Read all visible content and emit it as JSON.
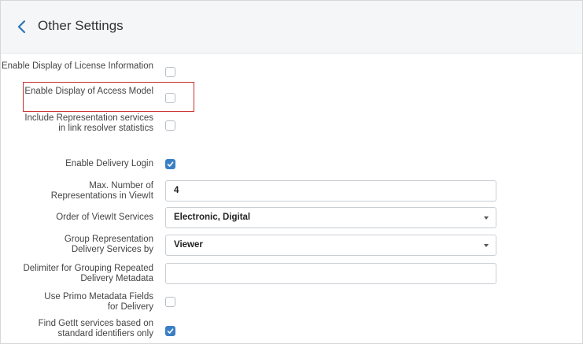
{
  "header": {
    "back_icon": "chevron-left-icon",
    "title": "Other Settings"
  },
  "settings": {
    "license_info": {
      "label": "Enable Display of License Information",
      "checked": false
    },
    "access_model": {
      "label": "Enable Display of Access Model",
      "checked": false,
      "highlighted": true
    },
    "representation_stats": {
      "label": "Include Representation services in link resolver statistics",
      "checked": false
    },
    "delivery_login": {
      "label": "Enable Delivery Login",
      "checked": true
    },
    "max_representations": {
      "label": "Max. Number of Representations in ViewIt",
      "value": "4"
    },
    "viewit_order": {
      "label": "Order of ViewIt Services",
      "value": "Electronic, Digital"
    },
    "group_by": {
      "label": "Group Representation Delivery Services by",
      "value": "Viewer"
    },
    "delimiter": {
      "label": "Delimiter for Grouping Repeated Delivery Metadata",
      "value": ""
    },
    "primo_metadata": {
      "label": "Use Primo Metadata Fields for Delivery",
      "checked": false
    },
    "getit_identifiers": {
      "label": "Find GetIt services based on standard identifiers only",
      "checked": true
    }
  },
  "colors": {
    "accent": "#3b7fc4",
    "highlight_border": "#c9302c",
    "header_bg": "#f4f6f8"
  }
}
